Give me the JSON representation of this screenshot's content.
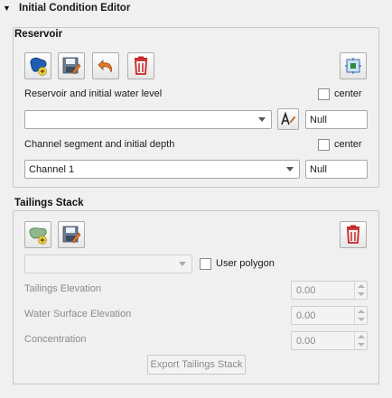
{
  "header": {
    "title": "Initial Condition Editor"
  },
  "reservoir": {
    "title": "Reservoir",
    "water_level_label": "Reservoir and initial water level",
    "center_label_1": "center",
    "reservoir_select_value": "",
    "water_level_value": "Null",
    "channel_label": "Channel segment and initial depth",
    "center_label_2": "center",
    "channel_select_value": "Channel 1",
    "depth_value": "Null",
    "icons": [
      "add-reservoir-icon",
      "save-icon",
      "undo-icon",
      "delete-icon",
      "zoom-to-icon",
      "field-name-icon"
    ]
  },
  "tailings": {
    "title": "Tailings Stack",
    "select_value": "",
    "user_polygon_label": "User polygon",
    "tailings_elevation_label": "Tailings Elevation",
    "tailings_elevation_value": "0.00",
    "water_surface_label": "Water Surface Elevation",
    "water_surface_value": "0.00",
    "concentration_label": "Concentration",
    "concentration_value": "0.00",
    "export_label": "Export Tailings Stack",
    "icons": [
      "add-polygon-icon",
      "save-icon",
      "delete-icon"
    ]
  },
  "colors": {
    "delete_red": "#c62828",
    "undo_orange": "#e07a2a",
    "reservoir_blue": "#1f5fae"
  }
}
